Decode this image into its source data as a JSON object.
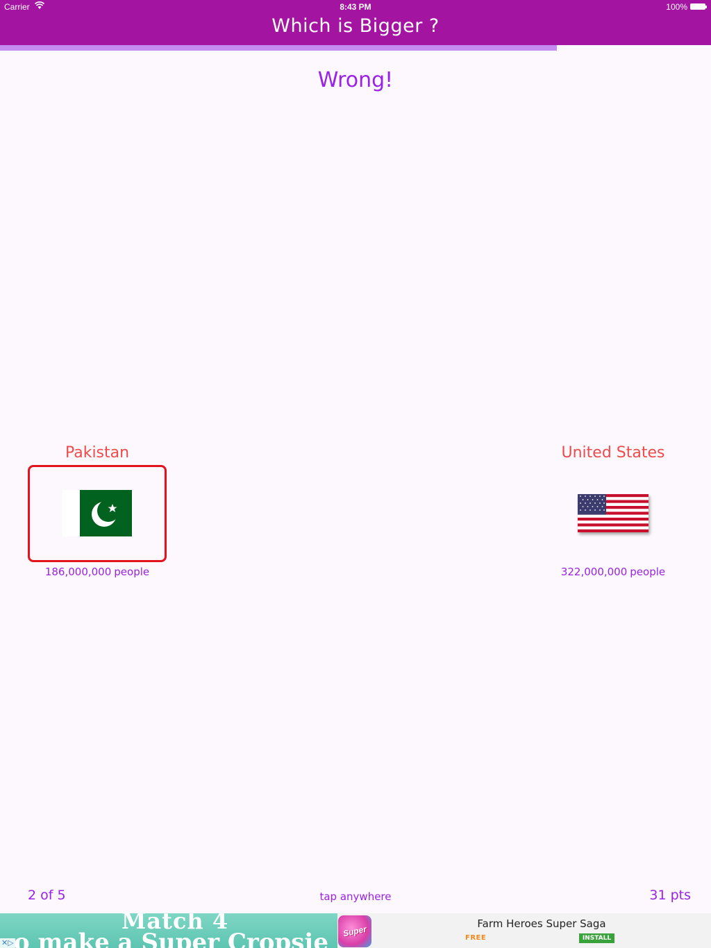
{
  "status_bar": {
    "carrier": "Carrier",
    "time": "8:43 PM",
    "battery": "100%"
  },
  "header": {
    "title": "Which is Bigger ?"
  },
  "progress": {
    "fraction": 0.783
  },
  "result": {
    "text": "Wrong!"
  },
  "countries": [
    {
      "name": "Pakistan",
      "population": "186,000,000",
      "unit": "people",
      "selected": true
    },
    {
      "name": "United States",
      "population": "322,000,000",
      "unit": "people",
      "selected": false
    }
  ],
  "footer": {
    "question_counter": "2 of 5",
    "hint": "tap anywhere",
    "score": "31 pts"
  },
  "ad": {
    "art_line1": "Match 4",
    "art_line2": "o make a Super Cropsie",
    "icon_label": "Super",
    "title": "Farm Heroes Super Saga",
    "price": "FREE",
    "install_label": "INSTALL"
  },
  "colors": {
    "header_bg": "#a314a0",
    "accent_purple": "#9a22e6",
    "country_red": "#ee4b4b",
    "selected_border": "#e4121c",
    "progress_fill": "#c48cf1",
    "page_bg": "#fdf8fd"
  }
}
